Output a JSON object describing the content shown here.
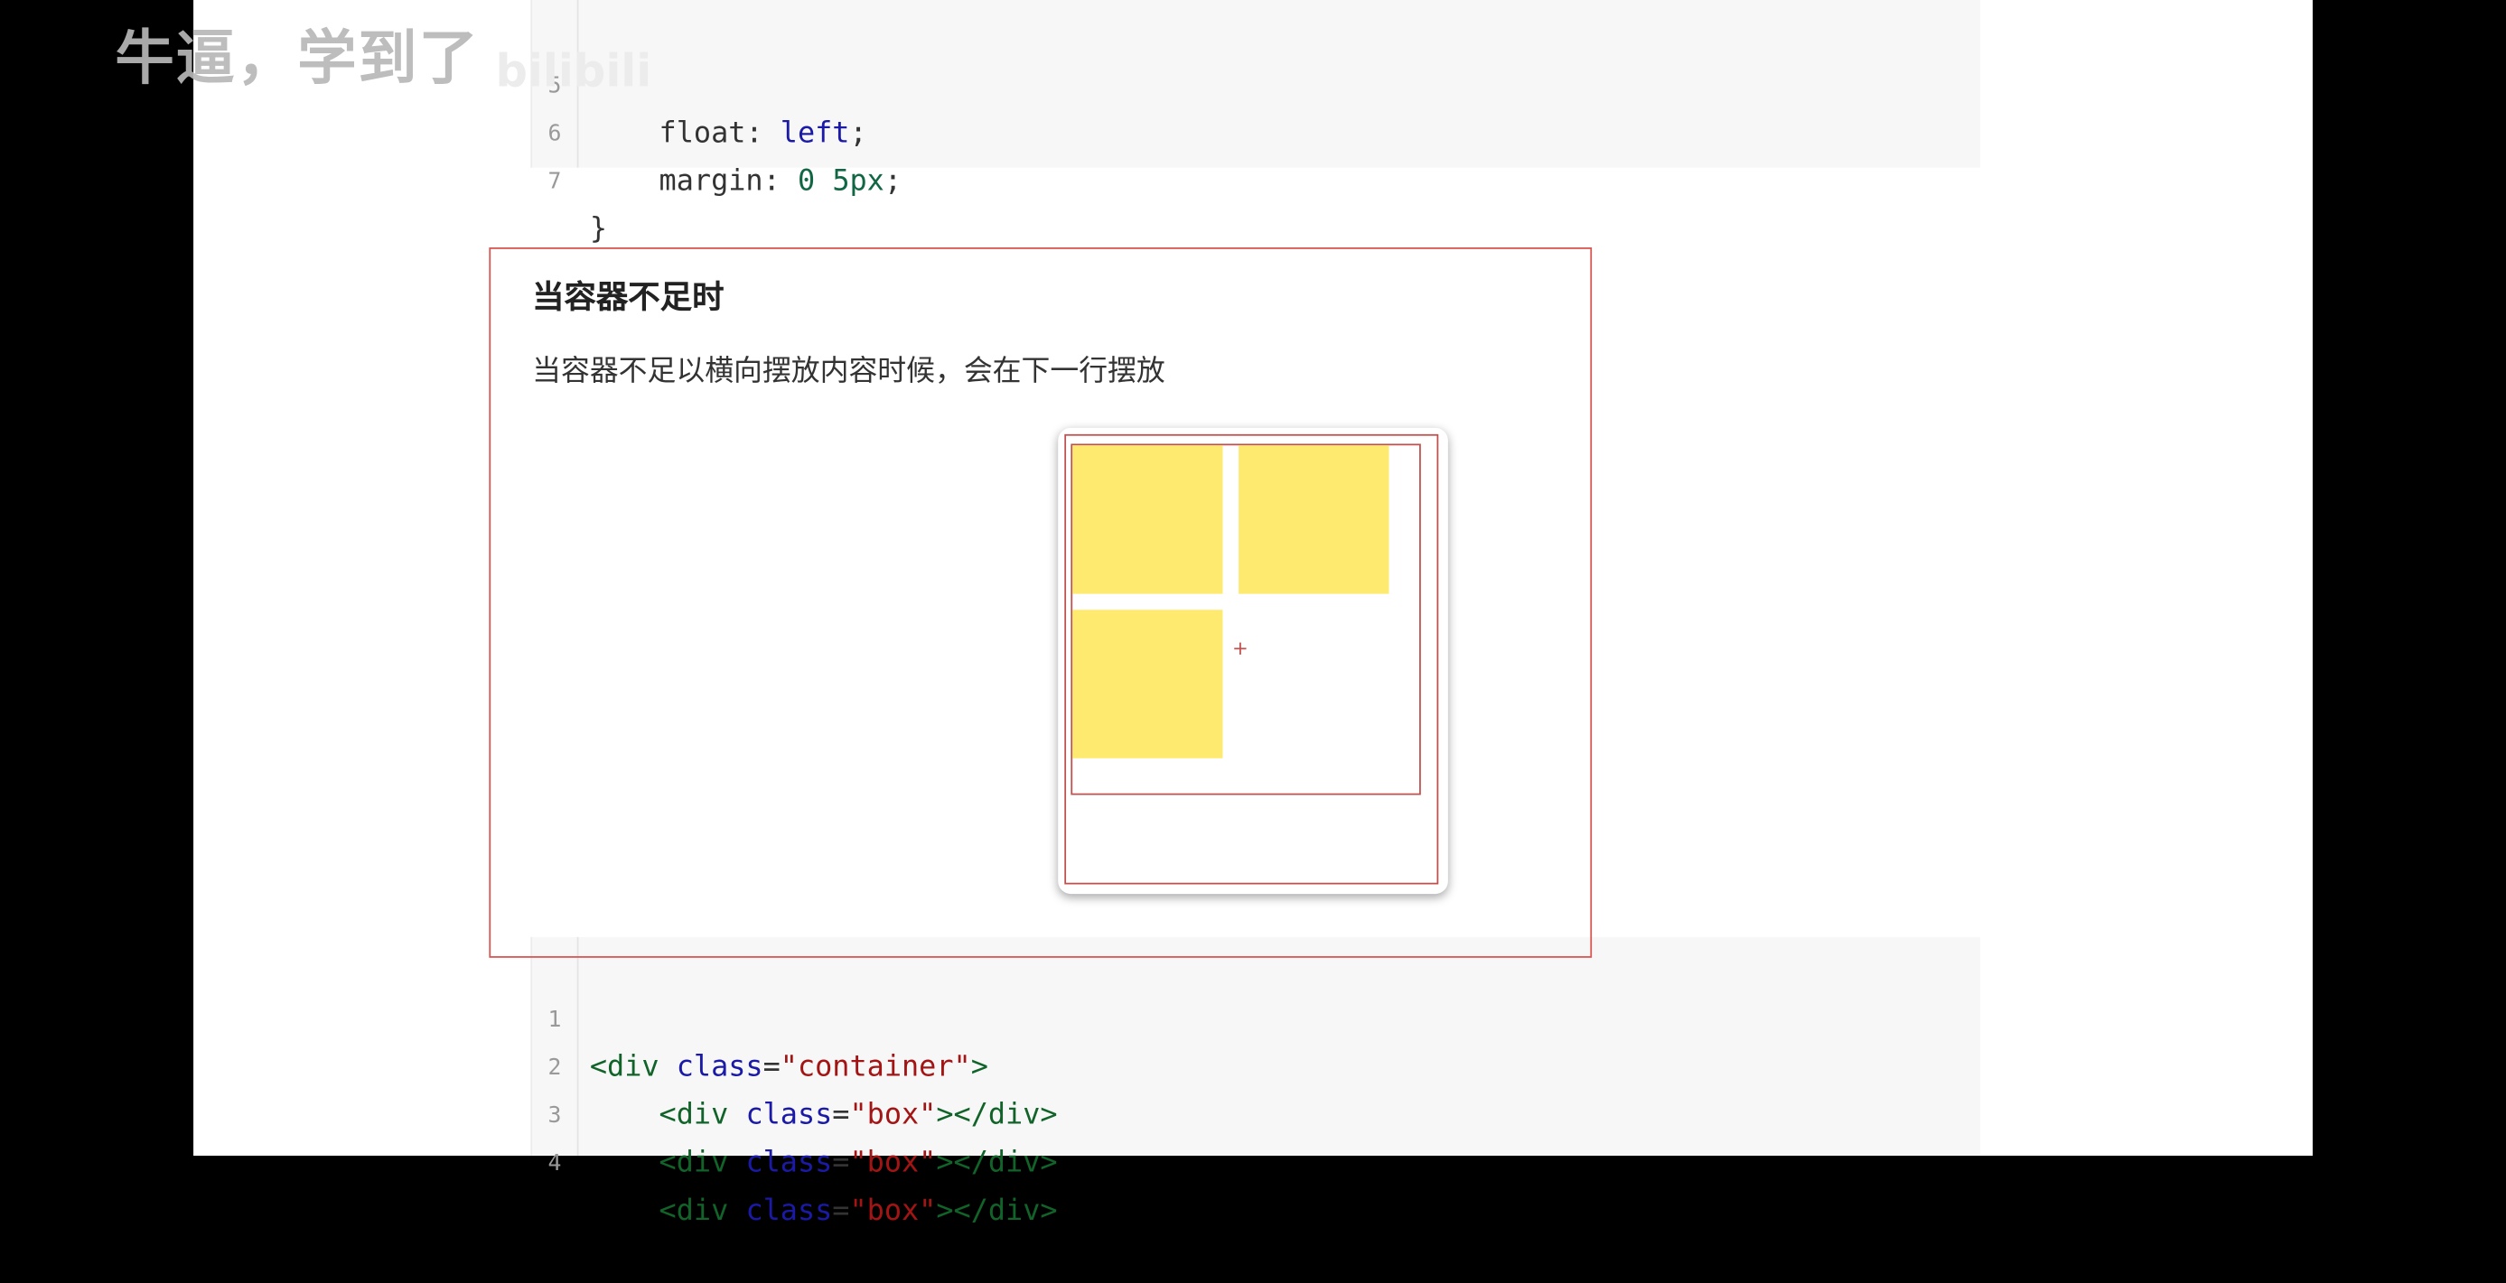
{
  "overlay": {
    "caption": "牛逼，学到了",
    "watermark": "bilibili"
  },
  "css_block": {
    "lines": [
      {
        "num": "5",
        "indent": "    ",
        "prop": "float",
        "value": "left"
      },
      {
        "num": "6",
        "indent": "    ",
        "prop": "margin",
        "value": "0 5px"
      },
      {
        "num": "7",
        "text": "}"
      }
    ]
  },
  "section": {
    "title": "当容器不足时",
    "description": "当容器不足以横向摆放内容时候，会在下一行摆放"
  },
  "demo": {
    "box_color": "#ffea70",
    "border_color": "#c0504d",
    "box_count": 3
  },
  "html_block": {
    "lines": [
      {
        "num": "1",
        "indent": "",
        "tag": "div",
        "attr": "class",
        "val": "\"container\"",
        "close": ">"
      },
      {
        "num": "2",
        "indent": "    ",
        "tag": "div",
        "attr": "class",
        "val": "\"box\"",
        "close": "></div>"
      },
      {
        "num": "3",
        "indent": "    ",
        "tag": "div",
        "attr": "class",
        "val": "\"box\"",
        "close": "></div>"
      },
      {
        "num": "4",
        "indent": "    ",
        "tag": "div",
        "attr": "class",
        "val": "\"box\"",
        "close": "></div>"
      }
    ]
  },
  "colors": {
    "highlight_frame": "#d9534f",
    "code_background": "#f7f7f8"
  }
}
